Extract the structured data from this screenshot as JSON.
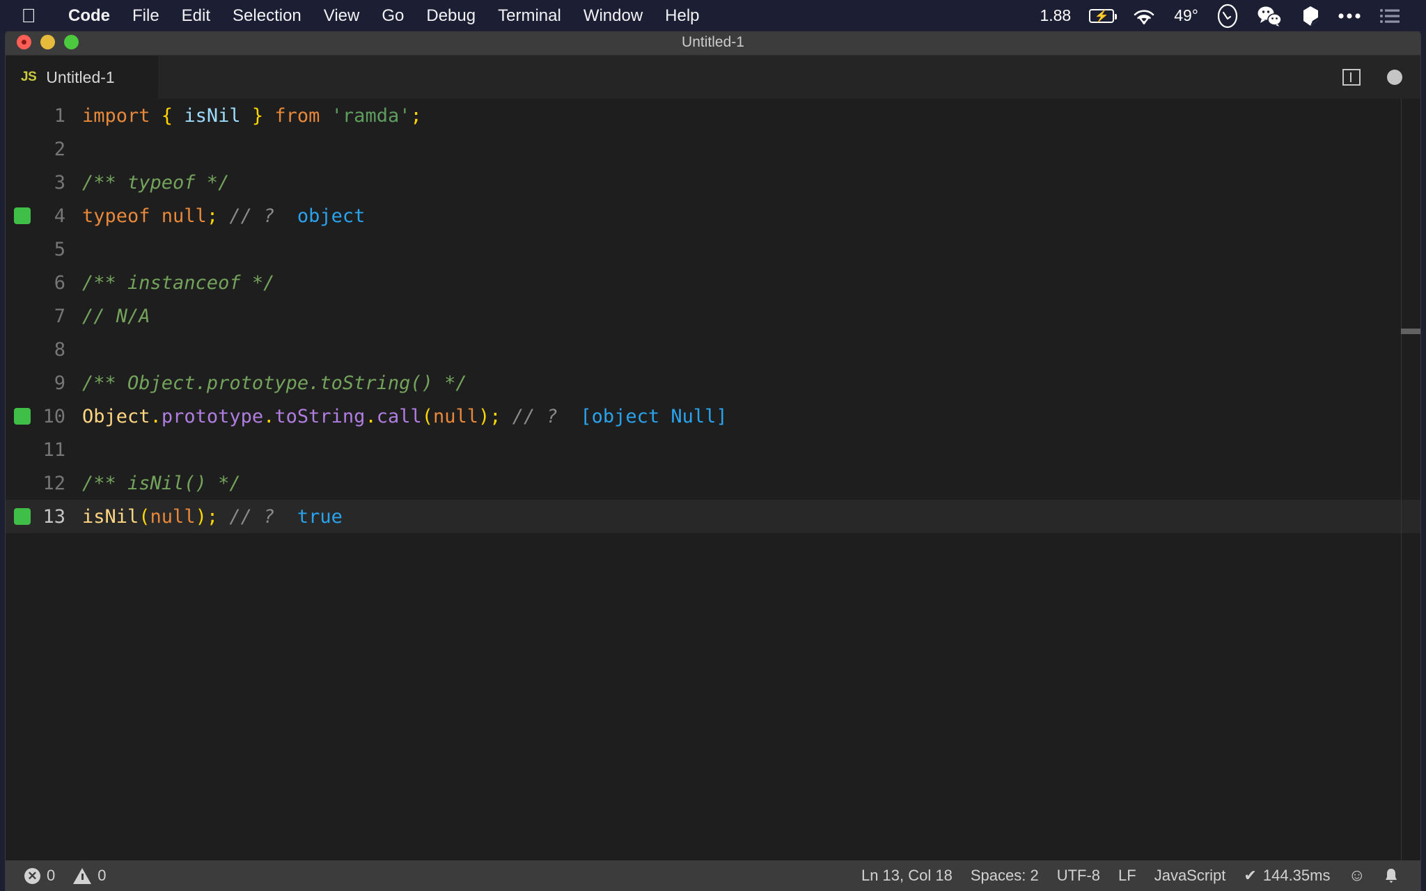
{
  "menubar": {
    "apple_icon": "apple-logo",
    "items": [
      {
        "label": "Code",
        "bold": true
      },
      {
        "label": "File"
      },
      {
        "label": "Edit"
      },
      {
        "label": "Selection"
      },
      {
        "label": "View"
      },
      {
        "label": "Go"
      },
      {
        "label": "Debug"
      },
      {
        "label": "Terminal"
      },
      {
        "label": "Window"
      },
      {
        "label": "Help"
      }
    ],
    "status": {
      "load": "1.88",
      "battery_icon": "battery-charging-icon",
      "battery_bolt": "⚡",
      "wifi_icon": "wifi-icon",
      "temperature": "49°",
      "clock_icon": "clock-circle-icon",
      "wechat_icon": "wechat-icon",
      "bartender_icon": "bartender-icon",
      "dots_icon": "ellipsis-icon",
      "list_icon": "list-icon"
    }
  },
  "window": {
    "title": "Untitled-1",
    "traffic_lights": {
      "close": "close-button",
      "minimize": "minimize-button",
      "maximize": "maximize-button"
    }
  },
  "tabbar": {
    "tab": {
      "file_type_icon": "JS",
      "label": "Untitled-1"
    },
    "actions": {
      "split_editor": "split-editor-icon",
      "unsaved_indicator": "unsaved-dot-icon"
    }
  },
  "editor": {
    "language": "javascript",
    "current_line": 13,
    "lines": [
      {
        "n": "1",
        "marker": false,
        "tokens": [
          {
            "t": "import ",
            "c": "t-kw"
          },
          {
            "t": "{",
            "c": "t-brace"
          },
          {
            "t": " isNil ",
            "c": "t-var"
          },
          {
            "t": "}",
            "c": "t-brace"
          },
          {
            "t": " from ",
            "c": "t-kw"
          },
          {
            "t": "'ramda'",
            "c": "t-str"
          },
          {
            "t": ";",
            "c": "t-punct"
          }
        ]
      },
      {
        "n": "2",
        "marker": false,
        "tokens": []
      },
      {
        "n": "3",
        "marker": false,
        "tokens": [
          {
            "t": "/** typeof */",
            "c": "t-comment"
          }
        ]
      },
      {
        "n": "4",
        "marker": true,
        "tokens": [
          {
            "t": "typeof null",
            "c": "t-kw"
          },
          {
            "t": ";",
            "c": "t-punct"
          },
          {
            "t": " // ? ",
            "c": "t-quokka"
          },
          {
            "t": " object",
            "c": "t-value"
          }
        ]
      },
      {
        "n": "5",
        "marker": false,
        "tokens": []
      },
      {
        "n": "6",
        "marker": false,
        "tokens": [
          {
            "t": "/** instanceof */",
            "c": "t-comment"
          }
        ]
      },
      {
        "n": "7",
        "marker": false,
        "tokens": [
          {
            "t": "// N/A",
            "c": "t-comment"
          }
        ]
      },
      {
        "n": "8",
        "marker": false,
        "tokens": []
      },
      {
        "n": "9",
        "marker": false,
        "tokens": [
          {
            "t": "/** Object.prototype.toString() */",
            "c": "t-comment"
          }
        ]
      },
      {
        "n": "10",
        "marker": true,
        "tokens": [
          {
            "t": "Object",
            "c": "t-obj"
          },
          {
            "t": ".",
            "c": "t-punct"
          },
          {
            "t": "prototype",
            "c": "t-prop"
          },
          {
            "t": ".",
            "c": "t-punct"
          },
          {
            "t": "toString",
            "c": "t-prop"
          },
          {
            "t": ".",
            "c": "t-punct"
          },
          {
            "t": "call",
            "c": "t-prop"
          },
          {
            "t": "(",
            "c": "t-punct"
          },
          {
            "t": "null",
            "c": "t-kw"
          },
          {
            "t": ");",
            "c": "t-punct"
          },
          {
            "t": " // ? ",
            "c": "t-quokka"
          },
          {
            "t": " [object Null]",
            "c": "t-value"
          }
        ]
      },
      {
        "n": "11",
        "marker": false,
        "tokens": []
      },
      {
        "n": "12",
        "marker": false,
        "tokens": [
          {
            "t": "/** isNil() */",
            "c": "t-comment"
          }
        ]
      },
      {
        "n": "13",
        "marker": true,
        "tokens": [
          {
            "t": "isNil",
            "c": "t-func"
          },
          {
            "t": "(",
            "c": "t-punct"
          },
          {
            "t": "null",
            "c": "t-kw"
          },
          {
            "t": ");",
            "c": "t-punct"
          },
          {
            "t": " // ? ",
            "c": "t-quokka"
          },
          {
            "t": " true",
            "c": "t-value"
          }
        ]
      }
    ],
    "raw_text": [
      "import { isNil } from 'ramda';",
      "",
      "/** typeof */",
      "typeof null; // ?  object",
      "",
      "/** instanceof */",
      "// N/A",
      "",
      "/** Object.prototype.toString() */",
      "Object.prototype.toString.call(null); // ?  [object Null]",
      "",
      "/** isNil() */",
      "isNil(null); // ?  true"
    ]
  },
  "statusbar": {
    "errors_count": "0",
    "warnings_count": "0",
    "cursor_position": "Ln 13, Col 18",
    "indentation": "Spaces: 2",
    "encoding": "UTF-8",
    "eol": "LF",
    "language_mode": "JavaScript",
    "quokka_check": "✔",
    "quokka_time": "144.35ms",
    "feedback_icon": "☺",
    "bell_icon": "🔔"
  },
  "colors": {
    "menubar_bg": "#1c1e34",
    "titlebar_bg": "#3c3c3c",
    "editor_bg": "#1e1e1e",
    "tabbar_bg": "#252526",
    "statusbar_bg": "#3c3c3c",
    "quokka_marker": "#3fbf47",
    "keyword": "#e8883a",
    "string": "#5f9e5f",
    "comment": "#74a35c",
    "value": "#2aa3ef",
    "property": "#b07ee0",
    "punct": "#ffd600"
  }
}
